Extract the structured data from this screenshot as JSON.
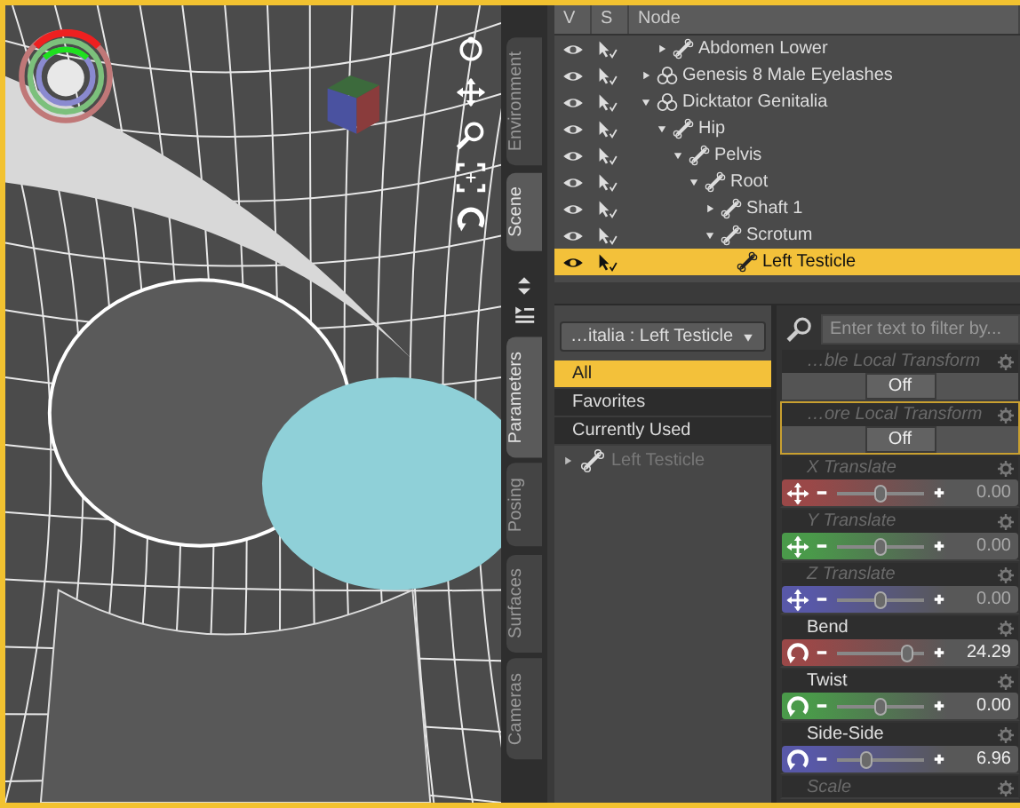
{
  "side_tabs": [
    {
      "label": "Environment",
      "selected": false
    },
    {
      "label": "Scene",
      "selected": true
    },
    {
      "label": "Parameters",
      "selected": true
    },
    {
      "label": "Posing",
      "selected": false
    },
    {
      "label": "Surfaces",
      "selected": false
    },
    {
      "label": "Cameras",
      "selected": false
    }
  ],
  "scene": {
    "columns": [
      "V",
      "S",
      "Node"
    ],
    "nodes": [
      {
        "label": "Abdomen Lower",
        "kind": "bone",
        "expanded": false,
        "selected": false
      },
      {
        "label": "Genesis 8 Male Eyelashes",
        "kind": "figure",
        "expanded": false,
        "selected": false
      },
      {
        "label": "Dicktator Genitalia",
        "kind": "figure",
        "expanded": true,
        "selected": false,
        "children": [
          {
            "label": "Hip",
            "kind": "bone",
            "expanded": true,
            "selected": false,
            "children": [
              {
                "label": "Pelvis",
                "kind": "bone",
                "expanded": true,
                "selected": false,
                "children": [
                  {
                    "label": "Root",
                    "kind": "bone",
                    "expanded": true,
                    "selected": false,
                    "children": [
                      {
                        "label": "Shaft 1",
                        "kind": "bone",
                        "expanded": false,
                        "selected": false
                      },
                      {
                        "label": "Scrotum",
                        "kind": "bone",
                        "expanded": true,
                        "selected": false,
                        "children": [
                          {
                            "label": "Left Testicle",
                            "kind": "bone",
                            "selected": true
                          }
                        ]
                      }
                    ]
                  }
                ]
              }
            ]
          }
        ]
      }
    ]
  },
  "parameters": {
    "node_menu": "…italia : Left Testicle",
    "groups": [
      {
        "label": "All",
        "selected": true
      },
      {
        "label": "Favorites",
        "selected": false
      },
      {
        "label": "Currently Used",
        "selected": false
      }
    ],
    "node_item": {
      "label": "Left Testicle",
      "expanded": false
    },
    "filter": {
      "placeholder": "Enter text to filter by..."
    },
    "properties": [
      {
        "kind": "toggle",
        "label": "…ble Local Transform",
        "value": "Off",
        "selected": false
      },
      {
        "kind": "toggle",
        "label": "…ore Local Transform",
        "value": "Off",
        "selected": true
      },
      {
        "kind": "translate",
        "label": "X Translate",
        "disabled": true,
        "color": "#9a4848",
        "level": 0.5,
        "reading": "0.00"
      },
      {
        "kind": "translate",
        "label": "Y Translate",
        "disabled": true,
        "color": "#4a9a4a",
        "level": 0.5,
        "reading": "0.00"
      },
      {
        "kind": "translate",
        "label": "Z Translate",
        "disabled": true,
        "color": "#5858a8",
        "level": 0.5,
        "reading": "0.00"
      },
      {
        "kind": "rotate",
        "label": "Bend",
        "disabled": false,
        "color": "#9a4848",
        "level": 0.82,
        "reading": "24.29"
      },
      {
        "kind": "rotate",
        "label": "Twist",
        "disabled": false,
        "color": "#4a9a4a",
        "level": 0.5,
        "reading": "0.00"
      },
      {
        "kind": "rotate",
        "label": "Side-Side",
        "disabled": false,
        "color": "#5858a8",
        "level": 0.34,
        "reading": "6.96"
      },
      {
        "kind": "header",
        "label": "Scale",
        "disabled": true
      }
    ]
  }
}
